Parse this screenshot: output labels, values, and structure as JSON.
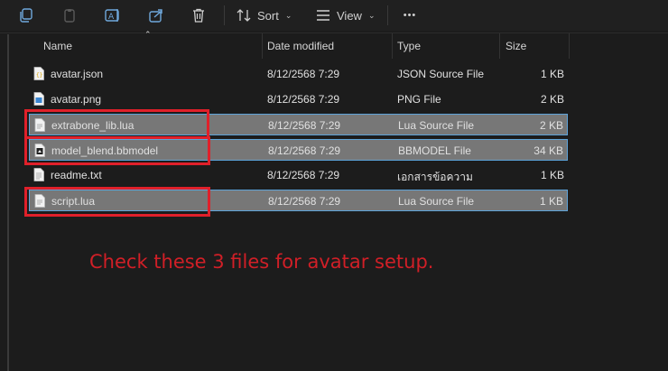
{
  "toolbar": {
    "sort_label": "Sort",
    "view_label": "View",
    "more_label": "•••"
  },
  "columns": {
    "name": "Name",
    "date": "Date modified",
    "type": "Type",
    "size": "Size"
  },
  "files": [
    {
      "name": "avatar.json",
      "date": "8/12/2568 7:29",
      "type": "JSON Source File",
      "size": "1 KB",
      "icon": "json-file-icon",
      "selected": false
    },
    {
      "name": "avatar.png",
      "date": "8/12/2568 7:29",
      "type": "PNG File",
      "size": "2 KB",
      "icon": "png-file-icon",
      "selected": false
    },
    {
      "name": "extrabone_lib.lua",
      "date": "8/12/2568 7:29",
      "type": "Lua Source File",
      "size": "2 KB",
      "icon": "lua-file-icon",
      "selected": true
    },
    {
      "name": "model_blend.bbmodel",
      "date": "8/12/2568 7:29",
      "type": "BBMODEL File",
      "size": "34 KB",
      "icon": "bbmodel-file-icon",
      "selected": true
    },
    {
      "name": "readme.txt",
      "date": "8/12/2568 7:29",
      "type": "เอกสารข้อความ",
      "size": "1 KB",
      "icon": "text-file-icon",
      "selected": false
    },
    {
      "name": "script.lua",
      "date": "8/12/2568 7:29",
      "type": "Lua Source File",
      "size": "1 KB",
      "icon": "lua-file-icon",
      "selected": true
    }
  ],
  "annotation": "Check these 3 files for avatar setup.",
  "colors": {
    "highlight": "#e0202a",
    "annotation_text": "#d11f27",
    "selection_border": "#5da3d9"
  }
}
